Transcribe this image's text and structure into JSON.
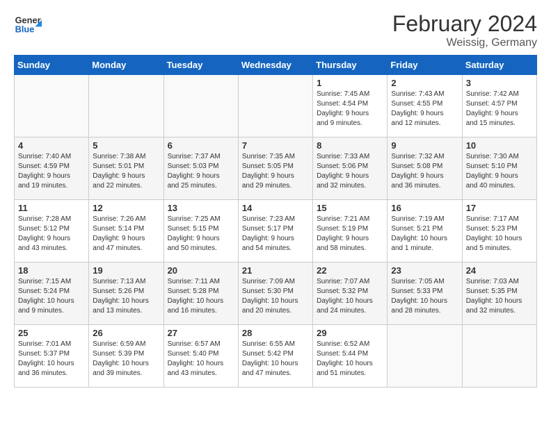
{
  "header": {
    "logo_general": "General",
    "logo_blue": "Blue",
    "title": "February 2024",
    "subtitle": "Weissig, Germany"
  },
  "calendar": {
    "days_of_week": [
      "Sunday",
      "Monday",
      "Tuesday",
      "Wednesday",
      "Thursday",
      "Friday",
      "Saturday"
    ],
    "weeks": [
      [
        {
          "day": "",
          "content": ""
        },
        {
          "day": "",
          "content": ""
        },
        {
          "day": "",
          "content": ""
        },
        {
          "day": "",
          "content": ""
        },
        {
          "day": "1",
          "content": "Sunrise: 7:45 AM\nSunset: 4:54 PM\nDaylight: 9 hours\nand 9 minutes."
        },
        {
          "day": "2",
          "content": "Sunrise: 7:43 AM\nSunset: 4:55 PM\nDaylight: 9 hours\nand 12 minutes."
        },
        {
          "day": "3",
          "content": "Sunrise: 7:42 AM\nSunset: 4:57 PM\nDaylight: 9 hours\nand 15 minutes."
        }
      ],
      [
        {
          "day": "4",
          "content": "Sunrise: 7:40 AM\nSunset: 4:59 PM\nDaylight: 9 hours\nand 19 minutes."
        },
        {
          "day": "5",
          "content": "Sunrise: 7:38 AM\nSunset: 5:01 PM\nDaylight: 9 hours\nand 22 minutes."
        },
        {
          "day": "6",
          "content": "Sunrise: 7:37 AM\nSunset: 5:03 PM\nDaylight: 9 hours\nand 25 minutes."
        },
        {
          "day": "7",
          "content": "Sunrise: 7:35 AM\nSunset: 5:05 PM\nDaylight: 9 hours\nand 29 minutes."
        },
        {
          "day": "8",
          "content": "Sunrise: 7:33 AM\nSunset: 5:06 PM\nDaylight: 9 hours\nand 32 minutes."
        },
        {
          "day": "9",
          "content": "Sunrise: 7:32 AM\nSunset: 5:08 PM\nDaylight: 9 hours\nand 36 minutes."
        },
        {
          "day": "10",
          "content": "Sunrise: 7:30 AM\nSunset: 5:10 PM\nDaylight: 9 hours\nand 40 minutes."
        }
      ],
      [
        {
          "day": "11",
          "content": "Sunrise: 7:28 AM\nSunset: 5:12 PM\nDaylight: 9 hours\nand 43 minutes."
        },
        {
          "day": "12",
          "content": "Sunrise: 7:26 AM\nSunset: 5:14 PM\nDaylight: 9 hours\nand 47 minutes."
        },
        {
          "day": "13",
          "content": "Sunrise: 7:25 AM\nSunset: 5:15 PM\nDaylight: 9 hours\nand 50 minutes."
        },
        {
          "day": "14",
          "content": "Sunrise: 7:23 AM\nSunset: 5:17 PM\nDaylight: 9 hours\nand 54 minutes."
        },
        {
          "day": "15",
          "content": "Sunrise: 7:21 AM\nSunset: 5:19 PM\nDaylight: 9 hours\nand 58 minutes."
        },
        {
          "day": "16",
          "content": "Sunrise: 7:19 AM\nSunset: 5:21 PM\nDaylight: 10 hours\nand 1 minute."
        },
        {
          "day": "17",
          "content": "Sunrise: 7:17 AM\nSunset: 5:23 PM\nDaylight: 10 hours\nand 5 minutes."
        }
      ],
      [
        {
          "day": "18",
          "content": "Sunrise: 7:15 AM\nSunset: 5:24 PM\nDaylight: 10 hours\nand 9 minutes."
        },
        {
          "day": "19",
          "content": "Sunrise: 7:13 AM\nSunset: 5:26 PM\nDaylight: 10 hours\nand 13 minutes."
        },
        {
          "day": "20",
          "content": "Sunrise: 7:11 AM\nSunset: 5:28 PM\nDaylight: 10 hours\nand 16 minutes."
        },
        {
          "day": "21",
          "content": "Sunrise: 7:09 AM\nSunset: 5:30 PM\nDaylight: 10 hours\nand 20 minutes."
        },
        {
          "day": "22",
          "content": "Sunrise: 7:07 AM\nSunset: 5:32 PM\nDaylight: 10 hours\nand 24 minutes."
        },
        {
          "day": "23",
          "content": "Sunrise: 7:05 AM\nSunset: 5:33 PM\nDaylight: 10 hours\nand 28 minutes."
        },
        {
          "day": "24",
          "content": "Sunrise: 7:03 AM\nSunset: 5:35 PM\nDaylight: 10 hours\nand 32 minutes."
        }
      ],
      [
        {
          "day": "25",
          "content": "Sunrise: 7:01 AM\nSunset: 5:37 PM\nDaylight: 10 hours\nand 36 minutes."
        },
        {
          "day": "26",
          "content": "Sunrise: 6:59 AM\nSunset: 5:39 PM\nDaylight: 10 hours\nand 39 minutes."
        },
        {
          "day": "27",
          "content": "Sunrise: 6:57 AM\nSunset: 5:40 PM\nDaylight: 10 hours\nand 43 minutes."
        },
        {
          "day": "28",
          "content": "Sunrise: 6:55 AM\nSunset: 5:42 PM\nDaylight: 10 hours\nand 47 minutes."
        },
        {
          "day": "29",
          "content": "Sunrise: 6:52 AM\nSunset: 5:44 PM\nDaylight: 10 hours\nand 51 minutes."
        },
        {
          "day": "",
          "content": ""
        },
        {
          "day": "",
          "content": ""
        }
      ]
    ]
  }
}
